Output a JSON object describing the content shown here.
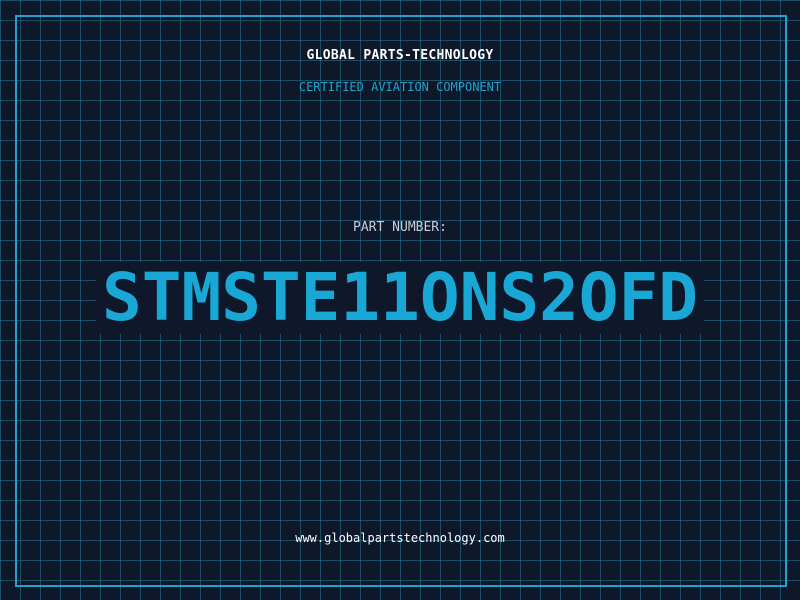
{
  "header": {
    "company_name": "GLOBAL PARTS-TECHNOLOGY",
    "subtitle": "CERTIFIED AVIATION COMPONENT"
  },
  "part": {
    "label": "PART NUMBER:",
    "number": "STMSTE11ONS2OFD"
  },
  "footer": {
    "website": "www.globalpartstechnology.com"
  },
  "colors": {
    "background": "#0f182b",
    "accent": "#1fa3cc",
    "part_number": "#19a8d6",
    "text": "#ffffff"
  }
}
